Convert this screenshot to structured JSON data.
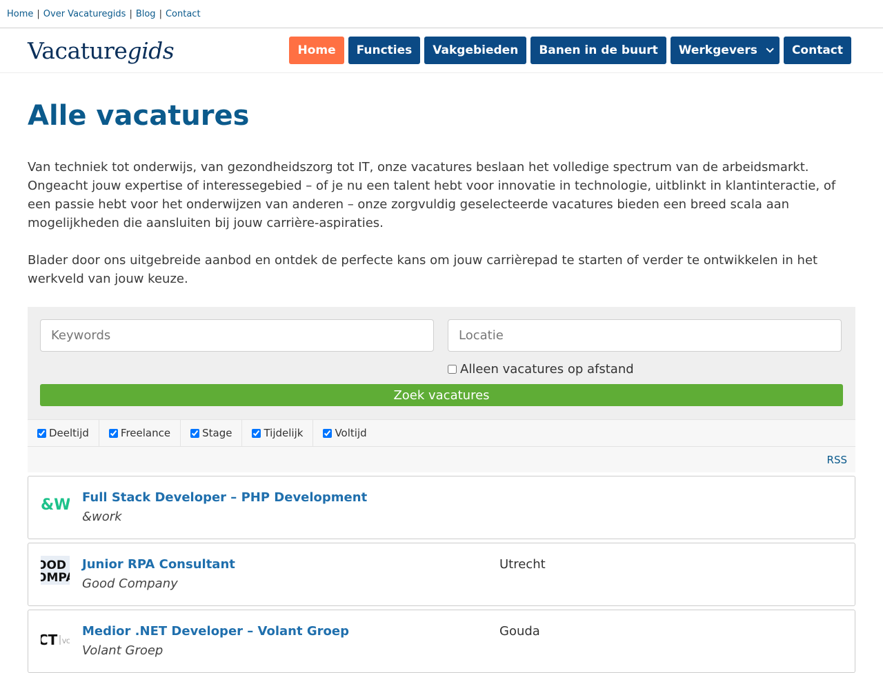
{
  "topbar": {
    "links": [
      "Home",
      "Over Vacaturegids",
      "Blog",
      "Contact"
    ]
  },
  "logo": {
    "regular": "Vacature",
    "italic": "gids"
  },
  "nav": {
    "items": [
      "Home",
      "Functies",
      "Vakgebieden",
      "Banen in de buurt",
      "Werkgevers",
      "Contact"
    ]
  },
  "page": {
    "title": "Alle vacatures",
    "intro": "Van techniek tot onderwijs, van gezondheidszorg tot IT, onze vacatures beslaan het volledige spectrum van de arbeidsmarkt. Ongeacht jouw expertise of interessegebied – of je nu een talent hebt voor innovatie in technologie, uitblinkt in klantinteractie, of een passie hebt voor het onderwijzen van anderen – onze zorgvuldig geselecteerde vacatures bieden een breed scala aan mogelijkheden die aansluiten bij jouw carrière-aspiraties.",
    "intro2": "Blader door ons uitgebreide aanbod en ontdek de perfecte kans om jouw carrièrepad te starten of verder te ontwikkelen in het werkveld van jouw keuze."
  },
  "search": {
    "keywords_placeholder": "Keywords",
    "location_placeholder": "Locatie",
    "remote_label": "Alleen vacatures op afstand",
    "submit_label": "Zoek vacatures"
  },
  "filters": {
    "types": [
      "Deeltijd",
      "Freelance",
      "Stage",
      "Tijdelijk",
      "Voltijd"
    ]
  },
  "rss_label": "RSS",
  "jobs": [
    {
      "title": "Full Stack Developer – PHP Development",
      "company": "&work",
      "location": "",
      "logo_text": "&W"
    },
    {
      "title": "Junior RPA Consultant",
      "company": "Good Company",
      "location": "Utrecht",
      "logo_text": "OOD OMPA"
    },
    {
      "title": "Medior .NET Developer – Volant Groep",
      "company": "Volant Groep",
      "location": "Gouda",
      "logo_text": "CT"
    }
  ],
  "colors": {
    "primary": "#0b4a85",
    "accent": "#ff7043",
    "success": "#5fad36",
    "link": "#0b5a8c"
  }
}
